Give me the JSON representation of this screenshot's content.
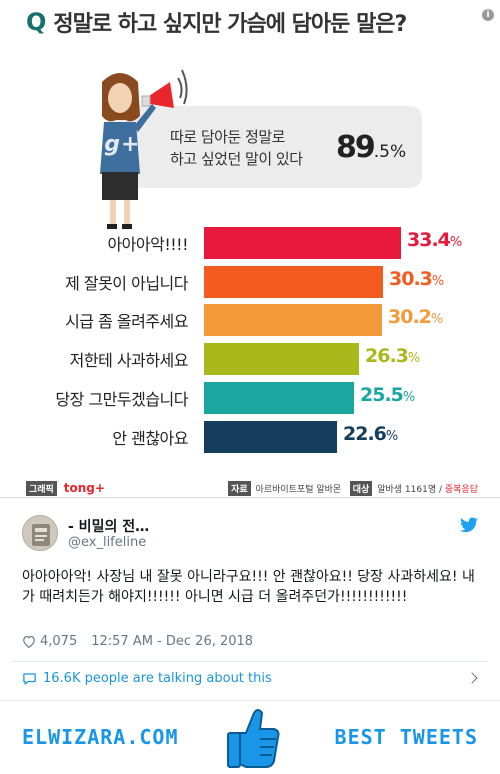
{
  "infographic": {
    "question_mark": "Q",
    "question": "정말로 하고 싶지만 가슴에 담아둔 말은?",
    "summary_line1": "따로 담아둔 정말로",
    "summary_line2": "하고 싶었던 말이 있다",
    "summary_value": "89",
    "summary_decimal": ".5%",
    "watermark": "tong+",
    "footer": {
      "graphic_chip": "그래픽",
      "brand": "tong+",
      "source_chip": "자료",
      "source": "아르바이트포털 알바몬",
      "target_chip": "대상",
      "target": "알바생 1161명 /",
      "note": "중복응답"
    }
  },
  "chart_data": {
    "type": "bar",
    "categories": [
      "아아아악!!!!",
      "제 잘못이 아닙니다",
      "시급 좀 올려주세요",
      "저한테 사과하세요",
      "당장 그만두겠습니다",
      "안 괜찮아요"
    ],
    "values": [
      33.4,
      30.3,
      30.2,
      26.3,
      25.5,
      22.6
    ],
    "value_labels": [
      {
        "main": "33.4",
        "unit": "%"
      },
      {
        "main": "30.3",
        "unit": "%"
      },
      {
        "main": "30.2",
        "unit": "%"
      },
      {
        "main": "26.3",
        "unit": "%"
      },
      {
        "main": "25.5",
        "unit": "%"
      },
      {
        "main": "22.6",
        "unit": "%"
      }
    ],
    "colors": [
      "#e8193d",
      "#f45b1f",
      "#f59a3b",
      "#a9b81a",
      "#1aa7a0",
      "#153e5c"
    ],
    "xlim": [
      0,
      40
    ],
    "title": "",
    "xlabel": "",
    "ylabel": ""
  },
  "tweet": {
    "display_name": "- ⁠비밀의 전…",
    "handle": "@ex_lifeline",
    "text": "아아아아악! 사장님 내 잘못 아니라구요!!! 안 괜찮아요!! 당장 사과하세요! 내가 때려치든가 해야지!!!!!! 아니면 시급 더 올려주던가!!!!!!!!!!!!",
    "likes": "4,075",
    "timestamp": "12:57 AM - Dec 26, 2018",
    "talking": "16.6K people are talking about this"
  },
  "banner": {
    "left": "ELWIZARA.COM",
    "right": "BEST TWEETS"
  },
  "icons": [
    "info-icon",
    "megaphone-icon",
    "twitter-bird-icon",
    "heart-icon",
    "comment-icon",
    "chevron-right-icon",
    "thumbs-up-icon"
  ]
}
